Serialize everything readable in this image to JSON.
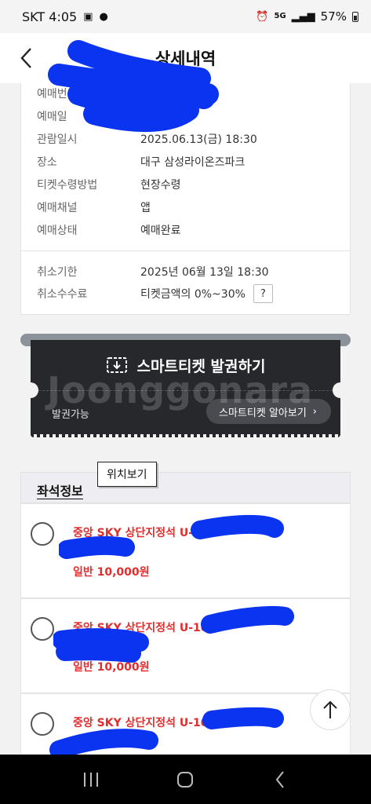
{
  "status_bar": {
    "carrier_time": "SKT 4:05",
    "battery": "57%",
    "network": "5G"
  },
  "header": {
    "title": "상세내역"
  },
  "info": {
    "rows": [
      {
        "label": "예매번호",
        "value": ""
      },
      {
        "label": "예매일",
        "value": ""
      },
      {
        "label": "관람일시",
        "value": "2025.06.13(금) 18:30"
      },
      {
        "label": "장소",
        "value": "대구 삼성라이온즈파크"
      },
      {
        "label": "티켓수령방법",
        "value": "현장수령"
      },
      {
        "label": "예매채널",
        "value": "앱"
      },
      {
        "label": "예매상태",
        "value": "예매완료"
      }
    ],
    "cancel_deadline_label": "취소기한",
    "cancel_deadline_value": "2025년 06월 13일 18:30",
    "cancel_fee_label": "취소수수료",
    "cancel_fee_value": "티켓금액의 0%~30%",
    "help_label": "?"
  },
  "ticket": {
    "issue_label": "스마트티켓 발권하기",
    "status": "발권가능",
    "info_button": "스마트티켓 알아보기"
  },
  "watermark": "Joonggonara",
  "seats": {
    "title": "좌석정보",
    "tooltip": "위치보기",
    "items": [
      {
        "name": "중앙 SKY 상단지정석 U-1",
        "price": "일반 10,000원"
      },
      {
        "name": "중앙 SKY 상단지정석 U-10",
        "price": "일반 10,000원"
      },
      {
        "name": "중앙 SKY 상단지정석 U-10",
        "price": ""
      }
    ]
  },
  "colors": {
    "accent_red": "#e12d2d",
    "redaction_blue": "#0a34f0",
    "ticket_dark": "#27282c"
  }
}
